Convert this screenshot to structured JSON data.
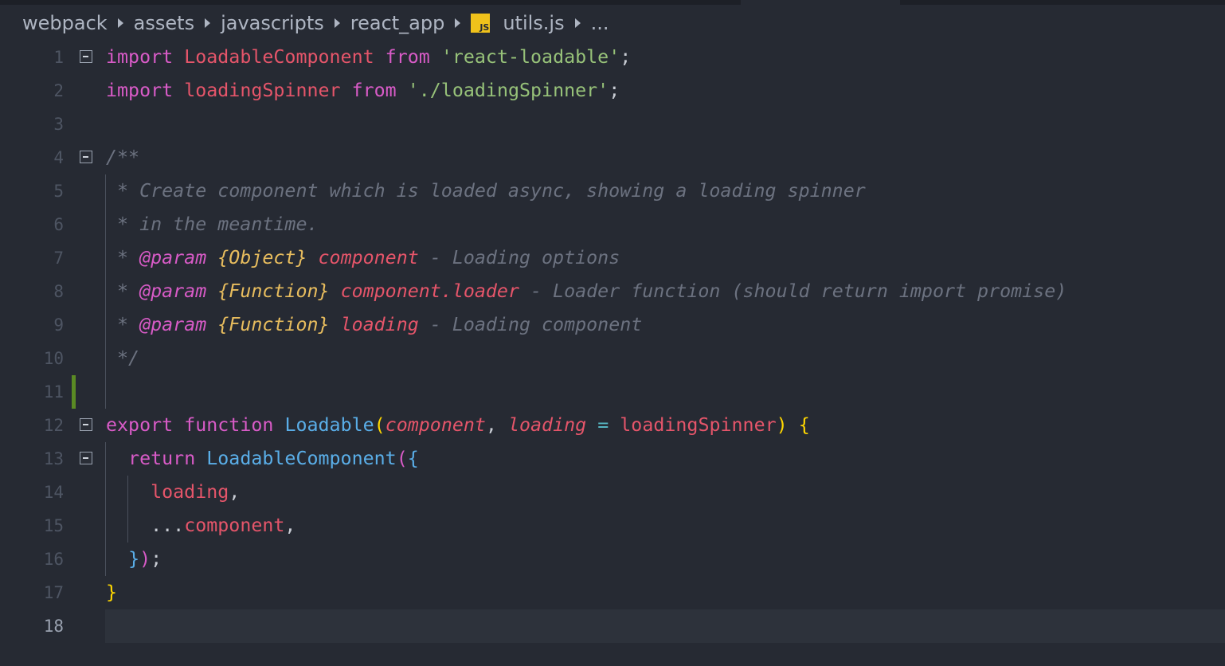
{
  "breadcrumb": {
    "items": [
      "webpack",
      "assets",
      "javascripts",
      "react_app"
    ],
    "file_badge": "JS",
    "file_name": "utils.js",
    "overflow": "..."
  },
  "editor": {
    "current_line": "18",
    "lines": [
      {
        "n": "1",
        "t": {
          "a": "import",
          "b": " ",
          "c": "LoadableComponent",
          "d": " ",
          "e": "from",
          "f": " ",
          "g": "'react-loadable'",
          "h": ";"
        }
      },
      {
        "n": "2",
        "t": {
          "a": "import",
          "b": " ",
          "c": "loadingSpinner",
          "d": " ",
          "e": "from",
          "f": " ",
          "g": "'./loadingSpinner'",
          "h": ";"
        }
      },
      {
        "n": "3",
        "t": {}
      },
      {
        "n": "4",
        "t": {
          "a": "/**"
        }
      },
      {
        "n": "5",
        "t": {
          "a": " * Create component which is loaded async, showing a loading spinner"
        }
      },
      {
        "n": "6",
        "t": {
          "a": " * in the meantime."
        }
      },
      {
        "n": "7",
        "t": {
          "a": " * ",
          "b": "@param",
          "c": " ",
          "d": "{Object}",
          "e": " ",
          "f": "component",
          "g": " - Loading options"
        }
      },
      {
        "n": "8",
        "t": {
          "a": " * ",
          "b": "@param",
          "c": " ",
          "d": "{Function}",
          "e": " ",
          "f": "component.loader",
          "g": " - Loader function (should return import promise)"
        }
      },
      {
        "n": "9",
        "t": {
          "a": " * ",
          "b": "@param",
          "c": " ",
          "d": "{Function}",
          "e": " ",
          "f": "loading",
          "g": " - Loading component"
        }
      },
      {
        "n": "10",
        "t": {
          "a": " */"
        }
      },
      {
        "n": "11",
        "t": {}
      },
      {
        "n": "12",
        "t": {
          "a": "export",
          "b": " ",
          "c": "function",
          "d": " ",
          "e": "Loadable",
          "f": "(",
          "g": "component",
          "h": ", ",
          "i": "loading",
          "j": " ",
          "k": "=",
          "l": " ",
          "m": "loadingSpinner",
          "n": ")",
          "o": " ",
          "p": "{"
        }
      },
      {
        "n": "13",
        "t": {
          "a": "  ",
          "b": "return",
          "c": " ",
          "d": "LoadableComponent",
          "e": "(",
          "f": "{"
        }
      },
      {
        "n": "14",
        "t": {
          "a": "    ",
          "b": "loading",
          "c": ","
        }
      },
      {
        "n": "15",
        "t": {
          "a": "    ",
          "b": "...",
          "c": "component",
          "d": ","
        }
      },
      {
        "n": "16",
        "t": {
          "a": "  ",
          "b": "}",
          "c": ")",
          "d": ";"
        }
      },
      {
        "n": "17",
        "t": {
          "a": "}"
        }
      },
      {
        "n": "18",
        "t": {}
      }
    ]
  }
}
